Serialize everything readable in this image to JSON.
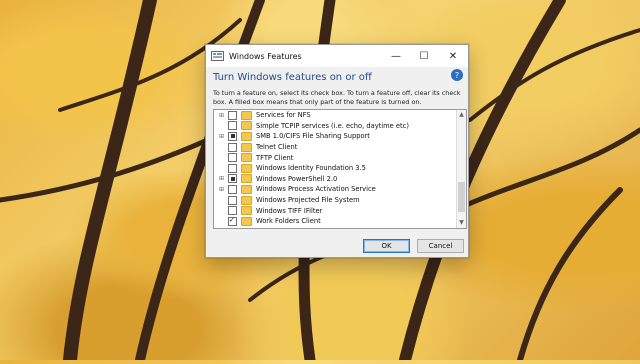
{
  "window": {
    "title": "Windows Features",
    "heading": "Turn Windows features on or off",
    "description": "To turn a feature on, select its check box. To turn a feature off, clear its check box. A filled box means that only part of the feature is turned on.",
    "help": "?",
    "minimize": "—",
    "maximize": "☐",
    "close": "✕"
  },
  "features": [
    {
      "label": "Services for NFS",
      "expand": "⊞",
      "state": "unchecked"
    },
    {
      "label": "Simple TCPIP services (i.e. echo, daytime etc)",
      "expand": "",
      "state": "unchecked"
    },
    {
      "label": "SMB 1.0/CIFS File Sharing Support",
      "expand": "⊞",
      "state": "partial"
    },
    {
      "label": "Telnet Client",
      "expand": "",
      "state": "unchecked"
    },
    {
      "label": "TFTP Client",
      "expand": "",
      "state": "unchecked"
    },
    {
      "label": "Windows Identity Foundation 3.5",
      "expand": "",
      "state": "unchecked"
    },
    {
      "label": "Windows PowerShell 2.0",
      "expand": "⊞",
      "state": "partial"
    },
    {
      "label": "Windows Process Activation Service",
      "expand": "⊞",
      "state": "unchecked"
    },
    {
      "label": "Windows Projected File System",
      "expand": "",
      "state": "unchecked"
    },
    {
      "label": "Windows TIFF IFilter",
      "expand": "",
      "state": "unchecked"
    },
    {
      "label": "Work Folders Client",
      "expand": "",
      "state": "checked"
    }
  ],
  "buttons": {
    "ok": "OK",
    "cancel": "Cancel"
  }
}
